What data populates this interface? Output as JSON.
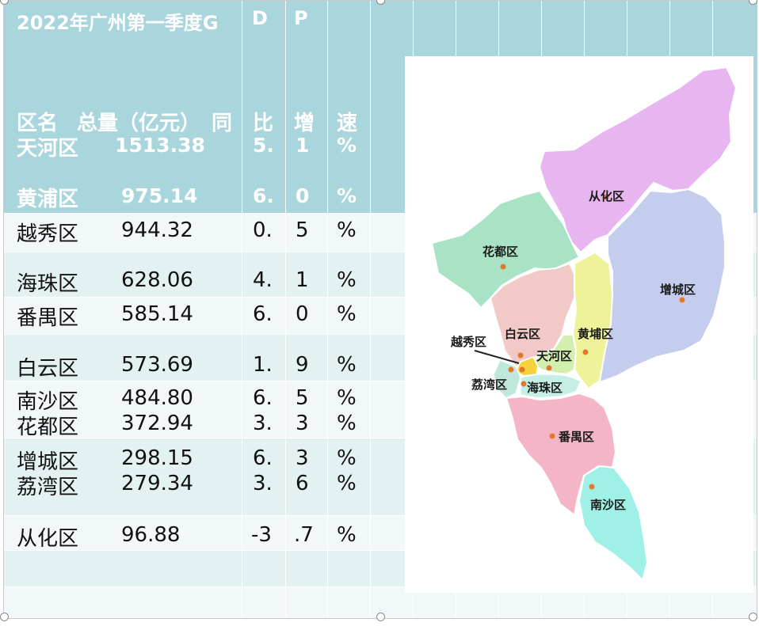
{
  "title": "2022年广州第一季度G",
  "title_letters": [
    "D",
    "P"
  ],
  "header": {
    "name": "区名",
    "total": "总量（亿元）",
    "yoy_parts": [
      "同",
      "比",
      "增",
      "速"
    ]
  },
  "rows": [
    {
      "name": "天河区",
      "total": "1513.38",
      "g1": "5.",
      "g2": "1",
      "pct": "%"
    },
    {
      "name": "黄浦区",
      "total": "975.14",
      "g1": "6.",
      "g2": "0",
      "pct": "%"
    },
    {
      "name": "越秀区",
      "total": "944.32",
      "g1": "0.",
      "g2": "5",
      "pct": "%"
    },
    {
      "name": "海珠区",
      "total": "628.06",
      "g1": "4.",
      "g2": "1",
      "pct": "%"
    },
    {
      "name": "番禺区",
      "total": "585.14",
      "g1": "6.",
      "g2": "0",
      "pct": "%"
    },
    {
      "name": "白云区",
      "total": "573.69",
      "g1": "1.",
      "g2": "9",
      "pct": "%"
    },
    {
      "name": "南沙区",
      "total": "484.80",
      "g1": "6.",
      "g2": "5",
      "pct": "%"
    },
    {
      "name": "花都区",
      "total": "372.94",
      "g1": "3.",
      "g2": "3",
      "pct": "%"
    },
    {
      "name": "增城区",
      "total": "298.15",
      "g1": "6.",
      "g2": "3",
      "pct": "%"
    },
    {
      "name": "荔湾区",
      "total": "279.34",
      "g1": "3.",
      "g2": "6",
      "pct": "%"
    },
    {
      "name": "从化区",
      "total": "96.88",
      "g1": "-3",
      "g2": ".7",
      "pct": "%"
    }
  ],
  "map": {
    "labels": {
      "conghua": "从化区",
      "huadu": "花都区",
      "zengcheng": "增城区",
      "baiyun": "白云区",
      "huangpu": "黄埔区",
      "yuexiu": "越秀区",
      "tianhe": "天河区",
      "liwan": "荔湾区",
      "haizhu": "海珠区",
      "panyu": "番禺区",
      "nansha": "南沙区"
    },
    "colors": {
      "conghua": "#e7b6f0",
      "huadu": "#a9e3c6",
      "zengcheng": "#c5cdef",
      "baiyun": "#f1c9c6",
      "huangpu": "#eef39a",
      "tianhe": "#d3efb0",
      "yuexiu": "#f6d33c",
      "liwan": "#bfe8dc",
      "haizhu": "#c4eee6",
      "panyu": "#f4b6c6",
      "nansha": "#9ff0e6"
    }
  }
}
